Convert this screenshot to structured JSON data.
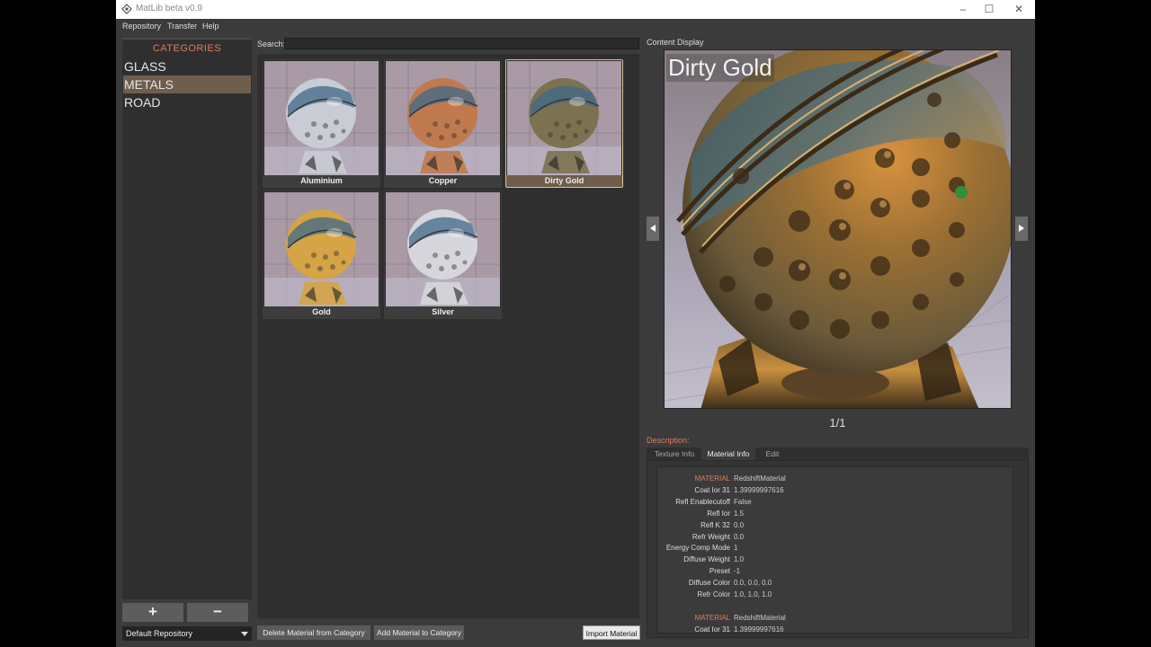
{
  "window": {
    "title": "MatLib beta v0.9"
  },
  "menu": [
    "Repository",
    "Transfer",
    "Help"
  ],
  "categories": {
    "header": "CATEGORIES",
    "items": [
      {
        "label": "GLASS",
        "selected": false
      },
      {
        "label": "METALS",
        "selected": true
      },
      {
        "label": "ROAD",
        "selected": false
      }
    ],
    "add_label": "+",
    "remove_label": "−",
    "repository": "Default Repository"
  },
  "search": {
    "label": "Search:",
    "value": ""
  },
  "materials": [
    {
      "name": "Aluminium",
      "tone": "#c9ccd4",
      "selected": false
    },
    {
      "name": "Copper",
      "tone": "#c07a4e",
      "selected": false
    },
    {
      "name": "Dirty Gold",
      "tone": "#7d7250",
      "selected": true
    },
    {
      "name": "Gold",
      "tone": "#d4a445",
      "selected": false
    },
    {
      "name": "Silver",
      "tone": "#d6d6dc",
      "selected": false
    }
  ],
  "buttons": {
    "delete": "Delete Material from Category",
    "add": "Add Material to Category",
    "import": "Import Material"
  },
  "content": {
    "label": "Content Display",
    "title": "Dirty Gold",
    "page": "1/1"
  },
  "description": {
    "label": "Description:",
    "tabs": [
      {
        "label": "Texture Info",
        "active": false
      },
      {
        "label": "Material Info",
        "active": true
      },
      {
        "label": "Edit",
        "active": false
      }
    ],
    "rows": [
      {
        "key": "MATERIAL",
        "value": "RedshiftMaterial",
        "highlight": true
      },
      {
        "key": "Coat Ior 31",
        "value": "1.39999997616",
        "highlight": false
      },
      {
        "key": "Refl Enablecutoff",
        "value": "False",
        "highlight": false
      },
      {
        "key": "Refl Ior",
        "value": "1.5",
        "highlight": false
      },
      {
        "key": "Refl K 32",
        "value": "0.0",
        "highlight": false
      },
      {
        "key": "Refr Weight",
        "value": "0.0",
        "highlight": false
      },
      {
        "key": "Energy Comp Mode",
        "value": "1",
        "highlight": false
      },
      {
        "key": "Diffuse Weight",
        "value": "1.0",
        "highlight": false
      },
      {
        "key": "Preset",
        "value": "-1",
        "highlight": false
      },
      {
        "key": "Diffuse Color",
        "value": "0.0, 0.0, 0.0",
        "highlight": false
      },
      {
        "key": "Refr Color",
        "value": "1.0, 1.0, 1.0",
        "highlight": false
      },
      {
        "key": "",
        "value": "",
        "highlight": false
      },
      {
        "key": "MATERIAL",
        "value": "RedshiftMaterial",
        "highlight": true
      },
      {
        "key": "Coat Ior 31",
        "value": "1.39999997616",
        "highlight": false
      }
    ]
  },
  "colors": {
    "accent": "#e07a5f",
    "selection": "#6f5d4d",
    "panel": "#2f2f2f"
  }
}
